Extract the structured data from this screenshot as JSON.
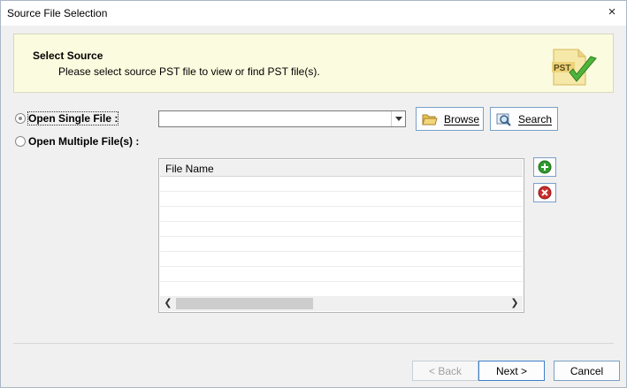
{
  "window": {
    "title": "Source File Selection",
    "close_glyph": "×"
  },
  "header": {
    "title": "Select Source",
    "subtitle": "Please select source PST file to view or find PST file(s).",
    "logo_text": "PST"
  },
  "options": {
    "single_label": "Open Single File :",
    "single_selected": true,
    "multiple_label": "Open Multiple File(s) :",
    "multiple_selected": false
  },
  "file_combo": {
    "value": ""
  },
  "buttons": {
    "browse_label": "Browse",
    "search_label": "Search"
  },
  "file_list": {
    "column_header": "File Name",
    "rows": []
  },
  "footer": {
    "back_label": "< Back",
    "next_label": "Next >",
    "cancel_label": "Cancel"
  },
  "colors": {
    "header_bg": "#fbfbdf",
    "button_border": "#7aa0c8",
    "add_icon": "#2f9a2f",
    "remove_icon": "#cc2b2b"
  }
}
